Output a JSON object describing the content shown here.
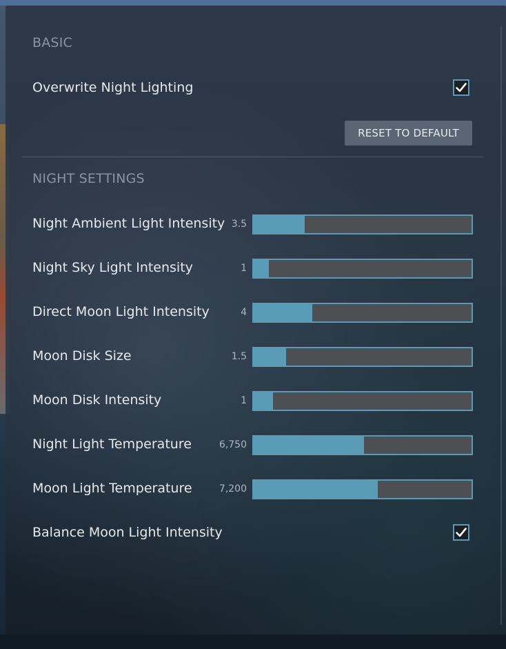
{
  "sections": {
    "basic_title": "BASIC",
    "night_title": "NIGHT SETTINGS"
  },
  "basic": {
    "overwrite_label": "Overwrite Night Lighting",
    "overwrite_checked": true,
    "reset_label": "RESET TO DEFAULT"
  },
  "sliders": [
    {
      "label": "Night Ambient Light Intensity",
      "value": "3.5",
      "fill": 0.235
    },
    {
      "label": "Night Sky Light Intensity",
      "value": "1",
      "fill": 0.07
    },
    {
      "label": "Direct Moon Light Intensity",
      "value": "4",
      "fill": 0.27
    },
    {
      "label": "Moon Disk Size",
      "value": "1.5",
      "fill": 0.15
    },
    {
      "label": "Moon Disk Intensity",
      "value": "1",
      "fill": 0.09
    },
    {
      "label": "Night Light Temperature",
      "value": "6,750",
      "fill": 0.505
    },
    {
      "label": "Moon Light Temperature",
      "value": "7,200",
      "fill": 0.57
    }
  ],
  "balance": {
    "label": "Balance Moon Light Intensity",
    "checked": true
  },
  "colors": {
    "accent": "#5a9cb8",
    "track": "#4d4f52",
    "label": "#e6eaee",
    "section": "#8a95a3"
  }
}
